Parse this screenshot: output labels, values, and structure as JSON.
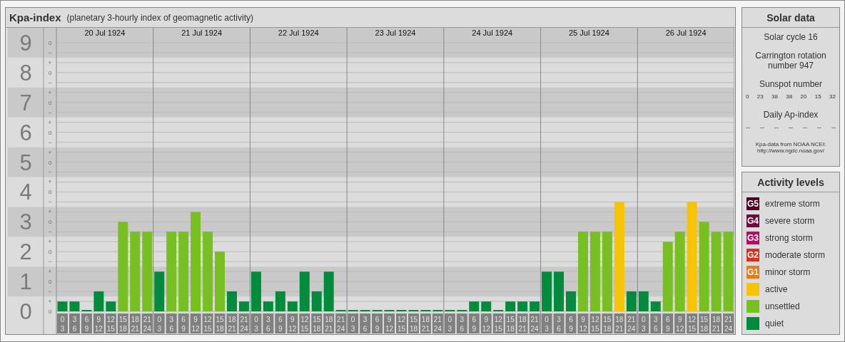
{
  "main_panel": {
    "title": "Kpa-index",
    "subtitle": "(planetary 3-hourly index of geomagnetic activity)",
    "sublevels": [
      "o",
      "−",
      "+",
      "o",
      "−",
      "+",
      "o",
      "−",
      "+",
      "o",
      "−",
      "+",
      "o",
      "−",
      "+",
      "o",
      "−",
      "+",
      "o",
      "−",
      "+",
      "o",
      "−",
      "+",
      "o",
      "−",
      "+",
      "o"
    ],
    "days": [
      {
        "date": "20 Jul 1924",
        "slots": [
          {
            "from": "0",
            "to": "3"
          },
          {
            "from": "3",
            "to": "6"
          },
          {
            "from": "6",
            "to": "9"
          },
          {
            "from": "9",
            "to": "12"
          },
          {
            "from": "12",
            "to": "15"
          },
          {
            "from": "15",
            "to": "18"
          },
          {
            "from": "18",
            "to": "21"
          },
          {
            "from": "21",
            "to": "24"
          }
        ]
      },
      {
        "date": "21 Jul 1924",
        "slots": [
          {
            "from": "0",
            "to": "3"
          },
          {
            "from": "3",
            "to": "6"
          },
          {
            "from": "6",
            "to": "9"
          },
          {
            "from": "9",
            "to": "12"
          },
          {
            "from": "12",
            "to": "15"
          },
          {
            "from": "15",
            "to": "18"
          },
          {
            "from": "18",
            "to": "21"
          },
          {
            "from": "21",
            "to": "24"
          }
        ]
      },
      {
        "date": "22 Jul 1924",
        "slots": [
          {
            "from": "0",
            "to": "3"
          },
          {
            "from": "3",
            "to": "6"
          },
          {
            "from": "6",
            "to": "9"
          },
          {
            "from": "9",
            "to": "12"
          },
          {
            "from": "12",
            "to": "15"
          },
          {
            "from": "15",
            "to": "18"
          },
          {
            "from": "18",
            "to": "21"
          },
          {
            "from": "21",
            "to": "24"
          }
        ]
      },
      {
        "date": "23 Jul 1924",
        "slots": [
          {
            "from": "0",
            "to": "3"
          },
          {
            "from": "3",
            "to": "6"
          },
          {
            "from": "6",
            "to": "9"
          },
          {
            "from": "9",
            "to": "12"
          },
          {
            "from": "12",
            "to": "15"
          },
          {
            "from": "15",
            "to": "18"
          },
          {
            "from": "18",
            "to": "21"
          },
          {
            "from": "21",
            "to": "24"
          }
        ]
      },
      {
        "date": "24 Jul 1924",
        "slots": [
          {
            "from": "0",
            "to": "3"
          },
          {
            "from": "3",
            "to": "6"
          },
          {
            "from": "6",
            "to": "9"
          },
          {
            "from": "9",
            "to": "12"
          },
          {
            "from": "12",
            "to": "15"
          },
          {
            "from": "15",
            "to": "18"
          },
          {
            "from": "18",
            "to": "21"
          },
          {
            "from": "21",
            "to": "24"
          }
        ]
      },
      {
        "date": "25 Jul 1924",
        "slots": [
          {
            "from": "0",
            "to": "3"
          },
          {
            "from": "3",
            "to": "6"
          },
          {
            "from": "6",
            "to": "9"
          },
          {
            "from": "9",
            "to": "12"
          },
          {
            "from": "12",
            "to": "15"
          },
          {
            "from": "15",
            "to": "18"
          },
          {
            "from": "18",
            "to": "21"
          },
          {
            "from": "21",
            "to": "24"
          }
        ]
      },
      {
        "date": "26 Jul 1924",
        "slots": [
          {
            "from": "0",
            "to": "3"
          },
          {
            "from": "3",
            "to": "6"
          },
          {
            "from": "6",
            "to": "9"
          },
          {
            "from": "9",
            "to": "12"
          },
          {
            "from": "12",
            "to": "15"
          },
          {
            "from": "15",
            "to": "18"
          },
          {
            "from": "18",
            "to": "21"
          },
          {
            "from": "21",
            "to": "24"
          }
        ]
      }
    ],
    "chart_data": {
      "type": "bar",
      "stacked": true,
      "grid": true,
      "ylim": [
        0,
        9.5
      ],
      "yticks": [
        {
          "value": 0,
          "label": "0"
        },
        {
          "value": 1,
          "label": "1"
        },
        {
          "value": 2,
          "label": "2"
        },
        {
          "value": 3,
          "label": "3"
        },
        {
          "value": 4,
          "label": "4"
        },
        {
          "value": 5,
          "label": "5"
        },
        {
          "value": 6,
          "label": "6"
        },
        {
          "value": 7,
          "label": "7"
        },
        {
          "value": 8,
          "label": "8"
        },
        {
          "value": 9,
          "label": "9"
        }
      ],
      "series": [
        {
          "name": "quiet",
          "color": "#008c3c",
          "values": [
            0.33,
            0.33,
            0,
            0.67,
            0.33,
            null,
            null,
            null,
            1.33,
            null,
            null,
            null,
            null,
            null,
            0.67,
            0.33,
            1.33,
            0.33,
            0.67,
            0.33,
            1.33,
            0.67,
            1.33,
            0,
            0,
            0,
            0,
            0,
            0,
            0,
            0,
            0,
            0,
            0,
            0.33,
            0.33,
            0,
            0.33,
            0.33,
            0.33,
            1.33,
            1.33,
            0.67,
            null,
            null,
            null,
            null,
            0.67,
            0.67,
            0.33,
            null,
            null,
            null,
            null,
            null,
            null
          ]
        },
        {
          "name": "unsettled",
          "color": "#78bf22",
          "values": [
            null,
            null,
            null,
            null,
            null,
            3,
            2.67,
            2.67,
            null,
            2.67,
            2.67,
            3.33,
            2.67,
            2,
            null,
            null,
            null,
            null,
            null,
            null,
            null,
            null,
            null,
            null,
            null,
            null,
            null,
            null,
            null,
            null,
            null,
            null,
            null,
            null,
            null,
            null,
            null,
            null,
            null,
            null,
            null,
            null,
            null,
            2.67,
            2.67,
            2.67,
            null,
            null,
            null,
            null,
            2.33,
            2.67,
            null,
            3,
            2.67,
            2.67
          ]
        },
        {
          "name": "active",
          "color": "#f8c400",
          "values": [
            null,
            null,
            null,
            null,
            null,
            null,
            null,
            null,
            null,
            null,
            null,
            null,
            null,
            null,
            null,
            null,
            null,
            null,
            null,
            null,
            null,
            null,
            null,
            null,
            null,
            null,
            null,
            null,
            null,
            null,
            null,
            null,
            null,
            null,
            null,
            null,
            null,
            null,
            null,
            null,
            null,
            null,
            null,
            null,
            null,
            null,
            3.67,
            null,
            null,
            null,
            null,
            null,
            3.67,
            null,
            null,
            null
          ]
        }
      ]
    }
  },
  "solar_data": {
    "title": "Solar data",
    "solar_cycle": "Solar cycle 16",
    "carrington": "Carrington rotation number 947",
    "sunspot_label": "Sunspot number",
    "sunspot_numbers": [
      "0",
      "23",
      "38",
      "38",
      "20",
      "15",
      "32"
    ],
    "ap_label": "Daily Ap-index",
    "ap_values": [
      "--",
      "--",
      "--",
      "--",
      "--",
      "--",
      "--"
    ],
    "source_note": "Kpa-data from NOAA NCEI:",
    "source_url": "http://www.ngdc.noaa.gov/"
  },
  "activity_levels": {
    "title": "Activity levels",
    "items": [
      {
        "badge": "G5",
        "label": "extreme storm",
        "color": "#4d0022"
      },
      {
        "badge": "G4",
        "label": "severe storm",
        "color": "#6e0a40"
      },
      {
        "badge": "G3",
        "label": "strong storm",
        "color": "#b0105e"
      },
      {
        "badge": "G2",
        "label": "moderate storm",
        "color": "#d5321e"
      },
      {
        "badge": "G1",
        "label": "minor storm",
        "color": "#e67a16"
      }
    ]
  }
}
